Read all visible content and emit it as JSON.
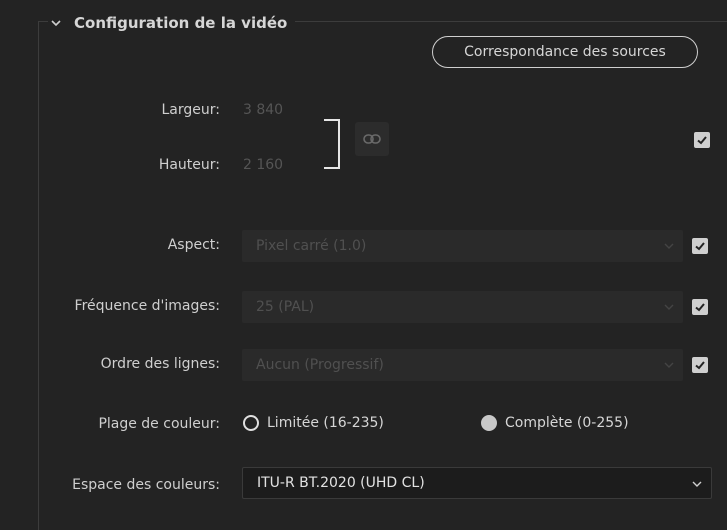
{
  "section": {
    "title": "Configuration de la vidéo"
  },
  "buttons": {
    "match_sources": "Correspondance des sources"
  },
  "dimensions": {
    "width_label": "Largeur:",
    "width_value": "3 840",
    "height_label": "Hauteur:",
    "height_value": "2 160"
  },
  "aspect": {
    "label": "Aspect:",
    "value": "Pixel carré (1.0)"
  },
  "frame_rate": {
    "label": "Fréquence d'images:",
    "value": "25 (PAL)"
  },
  "field_order": {
    "label": "Ordre des lignes:",
    "value": "Aucun (Progressif)"
  },
  "color_range": {
    "label": "Plage de couleur:",
    "options": [
      {
        "label": "Limitée (16-235)",
        "selected": false
      },
      {
        "label": "Complète (0-255)",
        "selected": true
      }
    ]
  },
  "color_space": {
    "label": "Espace des couleurs:",
    "value": "ITU-R BT.2020 (UHD CL)"
  },
  "colors": {
    "background": "#232323",
    "text": "#d2d2d2",
    "disabled_text": "#555555",
    "checkbox": "#cfcfcf"
  }
}
